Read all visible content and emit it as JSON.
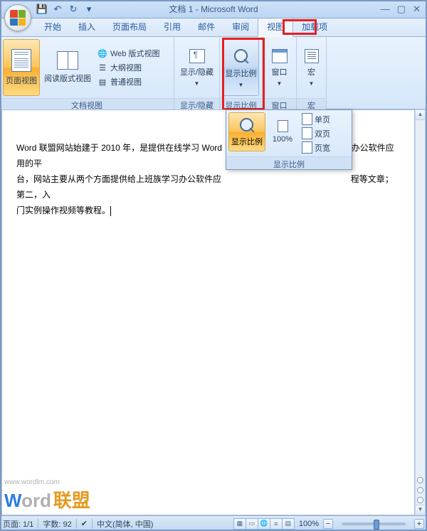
{
  "title": "文档 1 - Microsoft Word",
  "tabs": [
    "开始",
    "插入",
    "页面布局",
    "引用",
    "邮件",
    "审阅",
    "视图",
    "加载项"
  ],
  "active_tab": "视图",
  "ribbon": {
    "group1": {
      "label": "文档视图",
      "btn_page": "页面视图",
      "btn_read": "阅读版式视图",
      "items": [
        "Web 版式视图",
        "大纲视图",
        "普通视图"
      ]
    },
    "group2": {
      "label": "显示/隐藏",
      "btn": "显示/隐藏"
    },
    "group3": {
      "label": "显示比例",
      "btn": "显示比例"
    },
    "group4": {
      "label": "窗口",
      "btn": "窗口"
    },
    "group5": {
      "label": "宏",
      "btn": "宏"
    }
  },
  "dropdown": {
    "big": "显示比例",
    "pct": "100%",
    "items": [
      "单页",
      "双页",
      "页宽"
    ],
    "footer": "显示比例"
  },
  "document": {
    "line1_a": "Word 联盟网站始建于 2010 年，是提供在线学习 Word",
    "line1_b": "  办公软件应用的平",
    "line2_a": "台，网站主要从两个方面提供给上班族学习办公软件应",
    "line2_b": "程等文章；第二，入",
    "line3": "门实例操作视频等教程。"
  },
  "status": {
    "page": "页面: 1/1",
    "words": "字数: 92",
    "lang": "中文(简体, 中国)",
    "zoom": "100%"
  },
  "watermark": {
    "url": "www.wordlm.com",
    "w": "W",
    "ord": "ord",
    "cn": "联盟"
  }
}
